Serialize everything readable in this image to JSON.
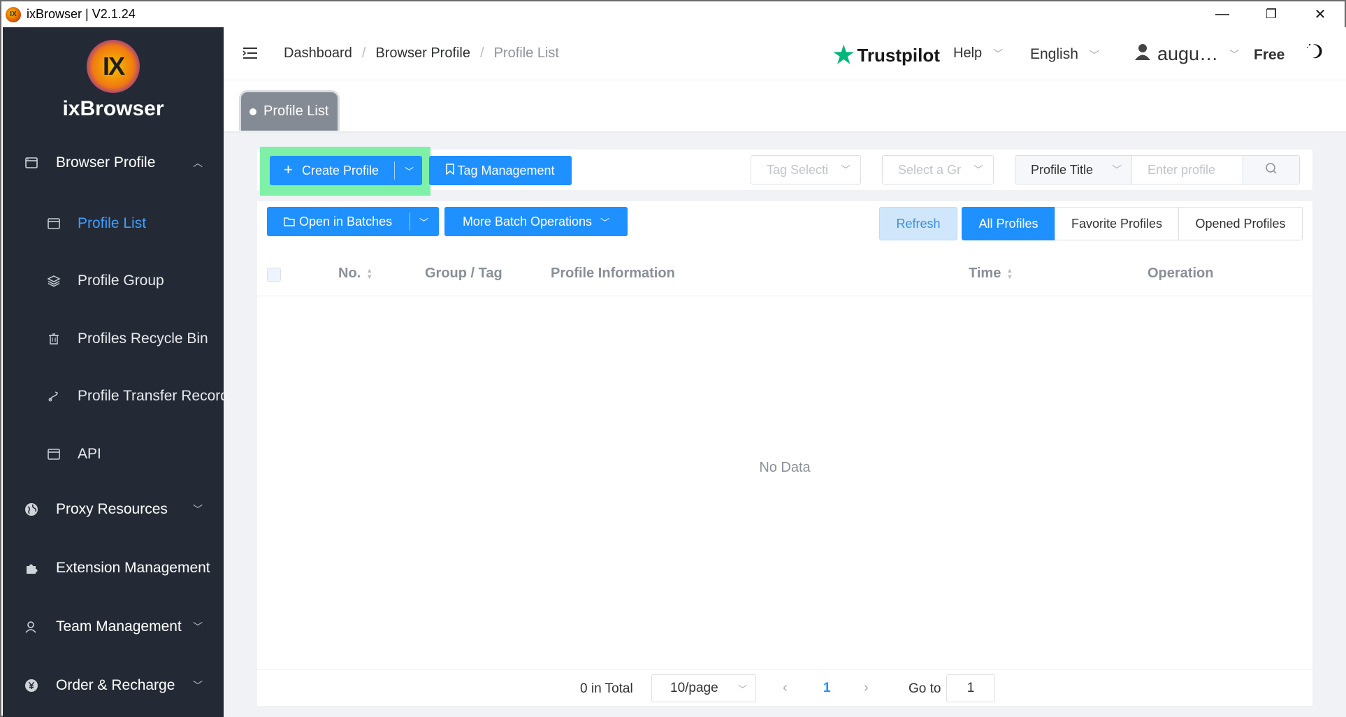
{
  "window": {
    "title": "ixBrowser | V2.1.24",
    "minimize": "—",
    "maximize": "❐",
    "close": "✕"
  },
  "sidebar": {
    "logo_text": "ixBrowser",
    "logo_mark": "IX",
    "items": [
      {
        "label": "Browser Profile",
        "icon": "browser-icon",
        "expanded": true
      },
      {
        "label": "Profile List",
        "icon": "window-icon",
        "active": true
      },
      {
        "label": "Profile Group",
        "icon": "layers-icon"
      },
      {
        "label": "Profiles Recycle Bin",
        "icon": "trash-icon"
      },
      {
        "label": "Profile Transfer Records",
        "icon": "transfer-icon"
      },
      {
        "label": "API",
        "icon": "api-icon"
      },
      {
        "label": "Proxy Resources",
        "icon": "globe-icon"
      },
      {
        "label": "Extension Management",
        "icon": "puzzle-icon"
      },
      {
        "label": "Team Management",
        "icon": "team-icon"
      },
      {
        "label": "Order & Recharge",
        "icon": "yen-icon"
      }
    ]
  },
  "header": {
    "breadcrumb": [
      "Dashboard",
      "Browser Profile",
      "Profile List"
    ],
    "trustpilot": "Trustpilot",
    "help": "Help",
    "language": "English",
    "user": "augu…",
    "plan": "Free"
  },
  "tabs": [
    {
      "label": "Profile List",
      "active": true
    }
  ],
  "toolbar": {
    "create_profile": "Create Profile",
    "tag_management": "Tag Management",
    "tag_select_placeholder": "Tag Selecti",
    "group_select_placeholder": "Select a Gr",
    "search_field": "Profile Title",
    "search_placeholder": "Enter profile"
  },
  "batch": {
    "open_in_batches": "Open in Batches",
    "more_batch": "More Batch Operations",
    "refresh": "Refresh",
    "filters": [
      {
        "label": "All Profiles",
        "active": true
      },
      {
        "label": "Favorite Profiles"
      },
      {
        "label": "Opened Profiles"
      }
    ]
  },
  "table": {
    "columns": [
      "No.",
      "Group / Tag",
      "Profile Information",
      "Time",
      "Operation"
    ],
    "rows": [],
    "empty_text": "No Data"
  },
  "pagination": {
    "total": "0 in Total",
    "page_size": "10/page",
    "current_page": "1",
    "goto_label": "Go to",
    "goto_value": "1"
  },
  "colors": {
    "accent": "#1e90ff",
    "sidebar_bg": "#232a35",
    "highlight": "#7ef0a8"
  }
}
